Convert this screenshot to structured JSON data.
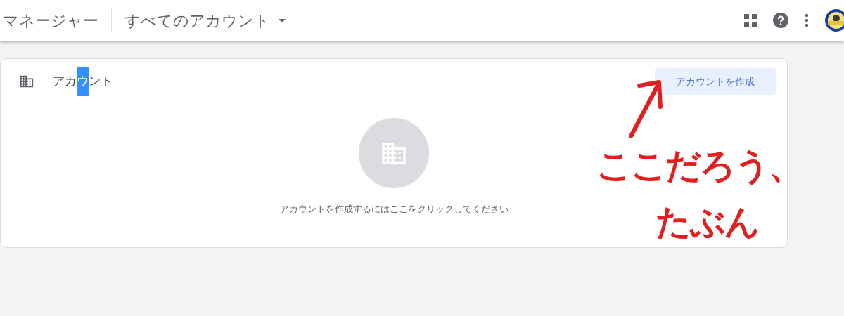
{
  "header": {
    "product": "マネージャー",
    "account_selector": "すべてのアカウント"
  },
  "card": {
    "title": {
      "before": "アカ",
      "selected": "ウ",
      "after": "ント"
    },
    "create_button": "アカウントを作成",
    "empty_message": "アカウントを作成するにはここをクリックしてください"
  },
  "annotation": {
    "lines": [
      "ここだろう、",
      "たぶん"
    ]
  }
}
